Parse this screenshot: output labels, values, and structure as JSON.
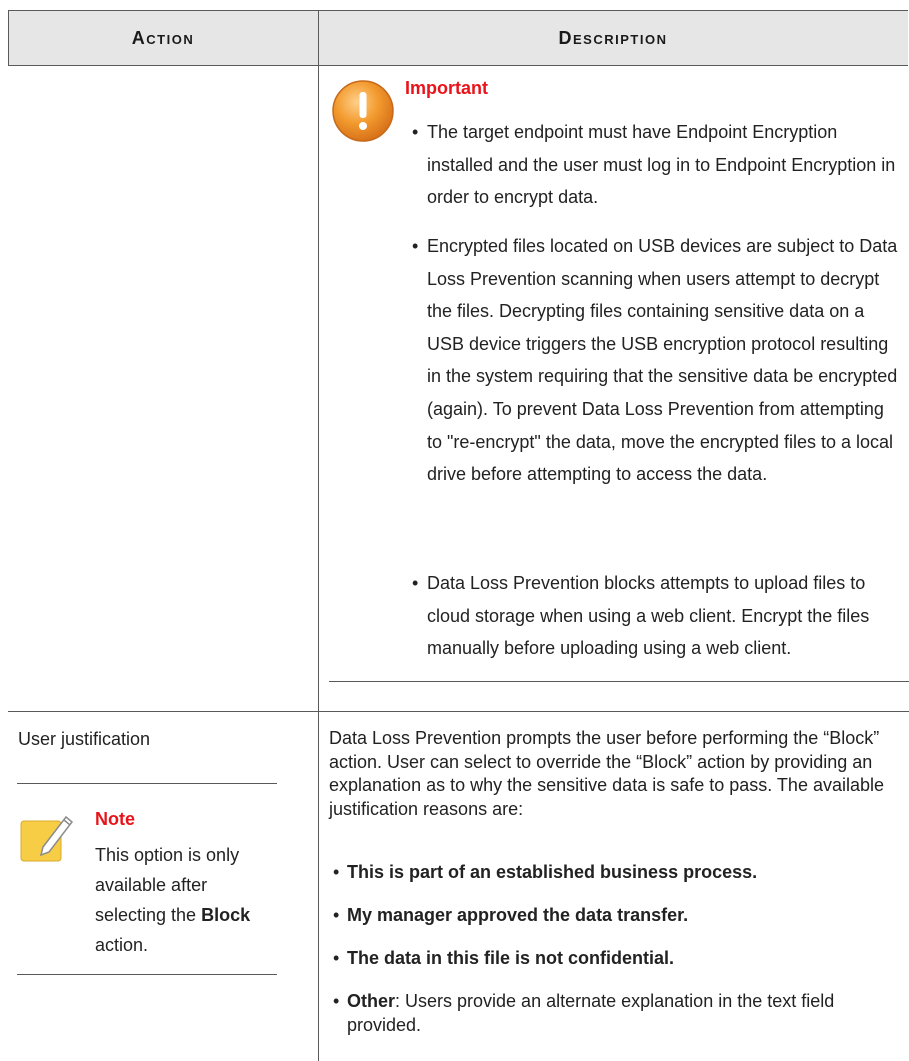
{
  "table": {
    "headers": {
      "action": "Action",
      "description": "Description"
    }
  },
  "important": {
    "title": "Important",
    "bullets": [
      "The target endpoint must have Endpoint Encryption installed and the user must log in to Endpoint Encryption in order to encrypt data.",
      "Encrypted files located on USB devices are subject to Data Loss Prevention scanning when users attempt to decrypt the files. Decrypting files containing sensitive data on a USB device triggers the USB encryption protocol resulting in the system requiring that the sensitive data be encrypted (again). To prevent Data Loss Prevention from attempting to \"re-encrypt\" the data, move the encrypted files to a local drive before attempting to access the data.",
      "Data Loss Prevention blocks attempts to upload files to cloud storage when using a web client. Encrypt the files manually before uploading using a web client."
    ]
  },
  "user_justification": {
    "action": "User justification",
    "note": {
      "title": "Note",
      "text_before": "This option is only available after selecting the ",
      "bold": "Block",
      "text_after": " action."
    },
    "description": "Data Loss Prevention prompts the user before performing the “Block” action. User can select to override the “Block” action by providing an explanation as to why the sensitive data is safe to pass. The available justification reasons are:",
    "reasons": [
      "This is part of an established business process.",
      "My manager approved the data transfer.",
      "The data in this file is not confidential."
    ],
    "other": {
      "bold": "Other",
      "text": ": Users provide an alternate explanation in the text field provided."
    }
  },
  "colors": {
    "accent_red": "#e8141b",
    "header_bg": "#e6e6e6",
    "important_orange": "#f29a2e",
    "note_yellow": "#f7cd45"
  }
}
